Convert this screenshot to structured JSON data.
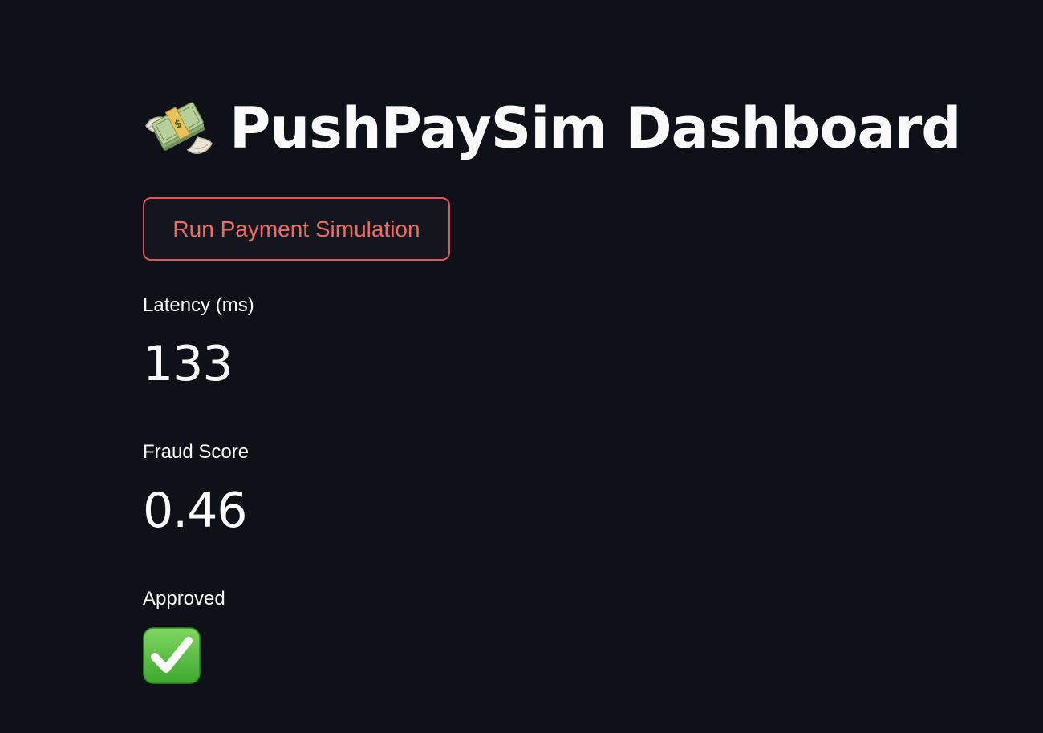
{
  "header": {
    "title": "PushPaySim Dashboard",
    "icon": "money-with-wings-icon"
  },
  "actions": {
    "run_label": "Run Payment Simulation"
  },
  "metrics": [
    {
      "label": "Latency (ms)",
      "value": "133"
    },
    {
      "label": "Fraud Score",
      "value": "0.46"
    },
    {
      "label": "Approved",
      "value_icon": "check-mark-button-icon"
    }
  ],
  "colors": {
    "background": "#0e1117",
    "text": "#fafafa",
    "accent": "#e0555a",
    "check_green": "#4cba3b"
  }
}
